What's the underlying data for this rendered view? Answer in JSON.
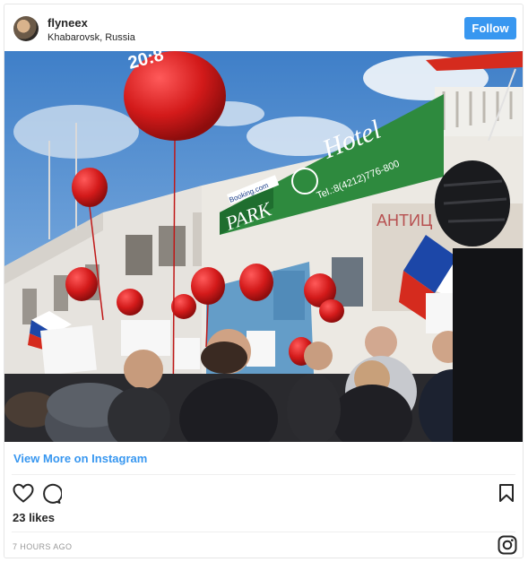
{
  "post": {
    "username": "flyneex",
    "location": "Khabarovsk, Russia",
    "follow_label": "Follow",
    "view_more_label": "View More on Instagram",
    "likes_text": "23 likes",
    "timestamp": "7 HOURS AGO"
  },
  "photo": {
    "hotel_sign_text": "Hotel",
    "park_sign_text": "PARK",
    "phone_text": "Tel.:8(4212)776-800",
    "booking_text": "Booking.com",
    "balloon_text": "20:8",
    "building_sign_text": "АНТИЦ"
  },
  "icons": {
    "like": "heart-icon",
    "comment": "comment-bubble-icon",
    "save": "bookmark-icon",
    "instagram": "instagram-logo-icon"
  },
  "colors": {
    "accent": "#3897f0",
    "text": "#262626",
    "muted": "#999999"
  }
}
